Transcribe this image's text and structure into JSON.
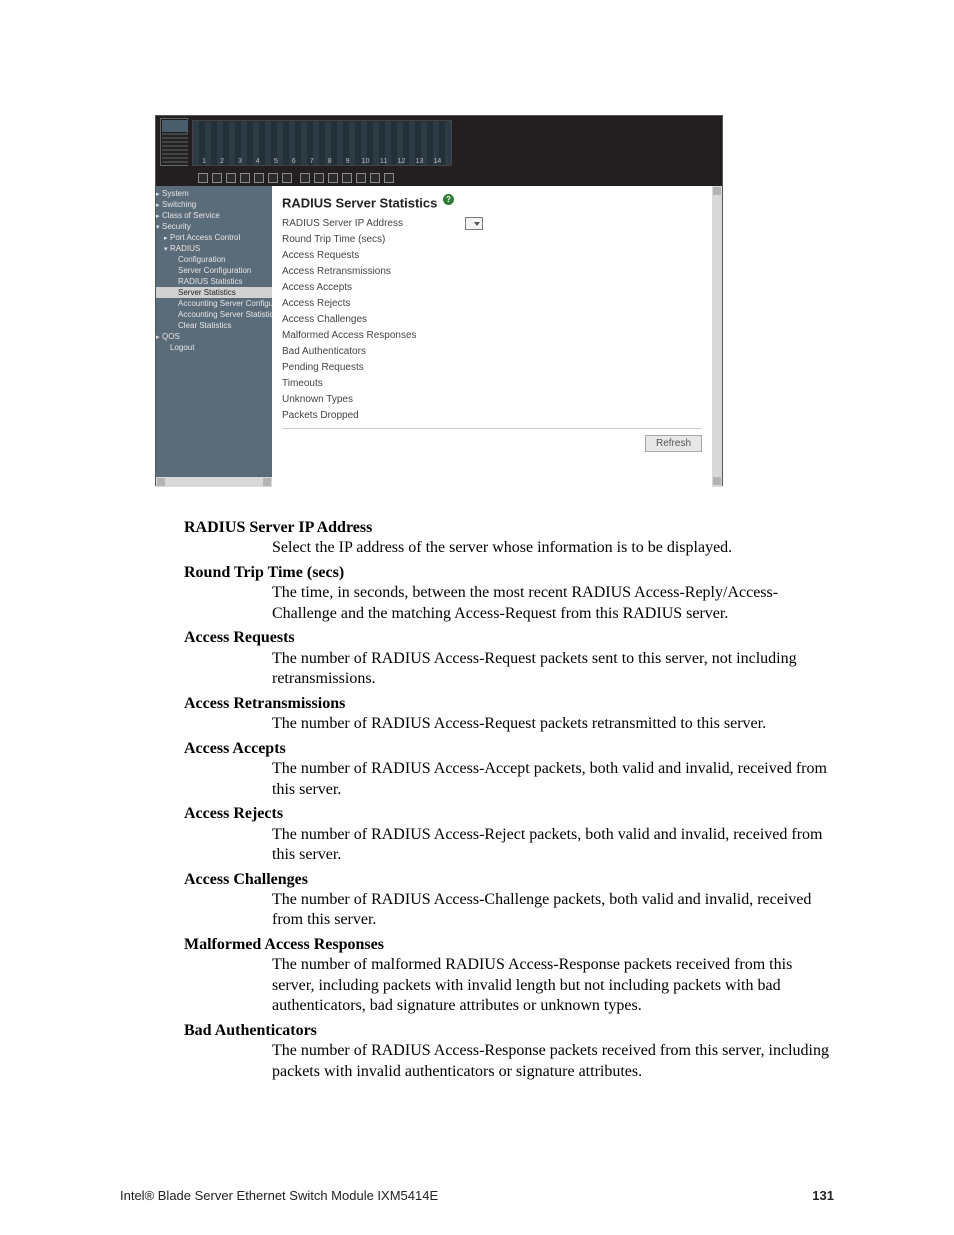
{
  "screenshot": {
    "port_numbers": [
      "1",
      "2",
      "3",
      "4",
      "5",
      "6",
      "7",
      "8",
      "9",
      "10",
      "11",
      "12",
      "13",
      "14"
    ],
    "nav": {
      "system": "System",
      "switching": "Switching",
      "class_of_service": "Class of Service",
      "security": "Security",
      "port_access_control": "Port Access Control",
      "radius": "RADIUS",
      "configuration": "Configuration",
      "server_configuration": "Server Configuration",
      "radius_statistics": "RADIUS Statistics",
      "server_statistics": "Server Statistics",
      "acct_server_config": "Accounting Server Configuratio",
      "acct_server_stats": "Accounting Server Statistics",
      "clear_statistics": "Clear Statistics",
      "qos": "QOS",
      "logout": "Logout"
    },
    "panel": {
      "title": "RADIUS Server Statistics",
      "help_glyph": "?",
      "rows": {
        "ip": "RADIUS Server IP Address",
        "rtt": "Round Trip Time (secs)",
        "req": "Access Requests",
        "retr": "Access Retransmissions",
        "acc": "Access Accepts",
        "rej": "Access Rejects",
        "chal": "Access Challenges",
        "mal": "Malformed Access Responses",
        "bad": "Bad Authenticators",
        "pend": "Pending Requests",
        "to": "Timeouts",
        "unk": "Unknown Types",
        "dropped": "Packets Dropped"
      },
      "refresh": "Refresh"
    }
  },
  "doc": {
    "t_ip": "RADIUS Server IP Address",
    "d_ip": "Select the IP address of the server whose information is to be displayed.",
    "t_rtt": "Round Trip Time (secs)",
    "d_rtt": "The time, in seconds, between the most recent RADIUS Access-Reply/Access-Challenge and the matching Access-Request from this RADIUS server.",
    "t_req": "Access Requests",
    "d_req": "The number of RADIUS Access-Request packets sent to this server, not including retransmissions.",
    "t_retr": "Access Retransmissions",
    "d_retr": "The number of RADIUS Access-Request packets retransmitted to this server.",
    "t_acc": "Access Accepts",
    "d_acc": "The number of RADIUS Access-Accept packets, both valid and invalid, received from this server.",
    "t_rej": "Access Rejects",
    "d_rej": "The number of RADIUS Access-Reject packets, both valid and invalid, received from this server.",
    "t_chal": "Access Challenges",
    "d_chal": "The number of RADIUS Access-Challenge packets, both valid and invalid, received from this server.",
    "t_mal": "Malformed Access Responses",
    "d_mal": "The number of malformed RADIUS Access-Response packets received from this server, including packets with invalid length but not including packets with bad authenticators, bad signature attributes or unknown types.",
    "t_bad": "Bad Authenticators",
    "d_bad": "The number of RADIUS Access-Response packets received from this server, including packets with invalid authenticators or signature attributes."
  },
  "footer": {
    "text": "Intel® Blade Server Ethernet Switch Module IXM5414E",
    "page": "131"
  }
}
